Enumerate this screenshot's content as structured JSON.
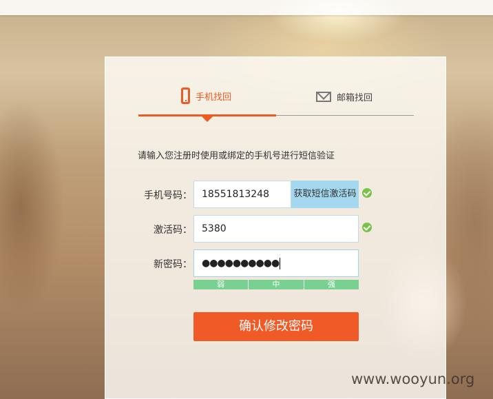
{
  "tabs": {
    "phone_label": "手机找回",
    "email_label": "邮箱找回"
  },
  "instruction": "请输入您注册时使用或绑定的手机号进行短信验证",
  "form": {
    "phone_label": "手机号码：",
    "phone_value": "18551813248",
    "sms_button_label": "获取短信激活码",
    "code_label": "激活码：",
    "code_value": "5380",
    "password_label": "新密码：",
    "password_value": "●●●●●●●●●●"
  },
  "strength": {
    "weak": "弱",
    "medium": "中",
    "strong": "强"
  },
  "submit_label": "确认修改密码",
  "watermark": "www.wooyun.org",
  "colors": {
    "accent": "#ee5a24",
    "check": "#78c24a",
    "strength": "#78d191",
    "sms_button": "#a3d8ef"
  }
}
